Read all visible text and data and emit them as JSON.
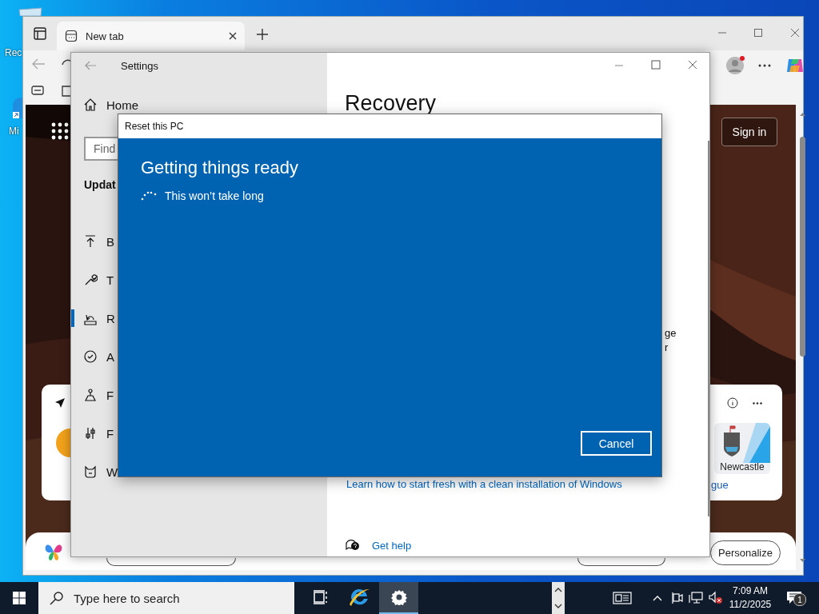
{
  "desktop": {
    "icons": [
      {
        "label": "Rec"
      },
      {
        "label": "Mi"
      }
    ]
  },
  "browser": {
    "tabs": [
      {
        "label": "New tab",
        "selected": true
      }
    ],
    "sign_in": "Sign in",
    "sports_card": {
      "team": "Newcastle",
      "link": "gue"
    },
    "personalize": "Personalize"
  },
  "settings": {
    "title": "Settings",
    "home": "Home",
    "search": {
      "placeholder": "Find"
    },
    "section": "Updat",
    "items": [
      {
        "label": "B",
        "selected": false
      },
      {
        "label": "T",
        "selected": false
      },
      {
        "label": "R",
        "selected": true
      },
      {
        "label": "A",
        "selected": false
      },
      {
        "label": "F",
        "selected": false
      },
      {
        "label": "F",
        "selected": false
      },
      {
        "label": "W",
        "selected": false
      }
    ],
    "heading": "Recovery",
    "fragments": [
      "ge",
      "r"
    ],
    "link": "Learn how to start fresh with a clean installation of Windows",
    "help": "Get help"
  },
  "dialog": {
    "title": "Reset this PC",
    "heading": "Getting things ready",
    "status": "This won’t take long",
    "button": "Cancel"
  },
  "taskbar": {
    "search": {
      "placeholder": "Type here to search"
    },
    "apps": [
      {
        "kind": "task-view",
        "selected": false
      },
      {
        "kind": "browser",
        "selected": false
      },
      {
        "kind": "settings",
        "selected": true
      }
    ],
    "time": "7:09 AM",
    "date": "11/2/2025",
    "notifications": "1"
  }
}
